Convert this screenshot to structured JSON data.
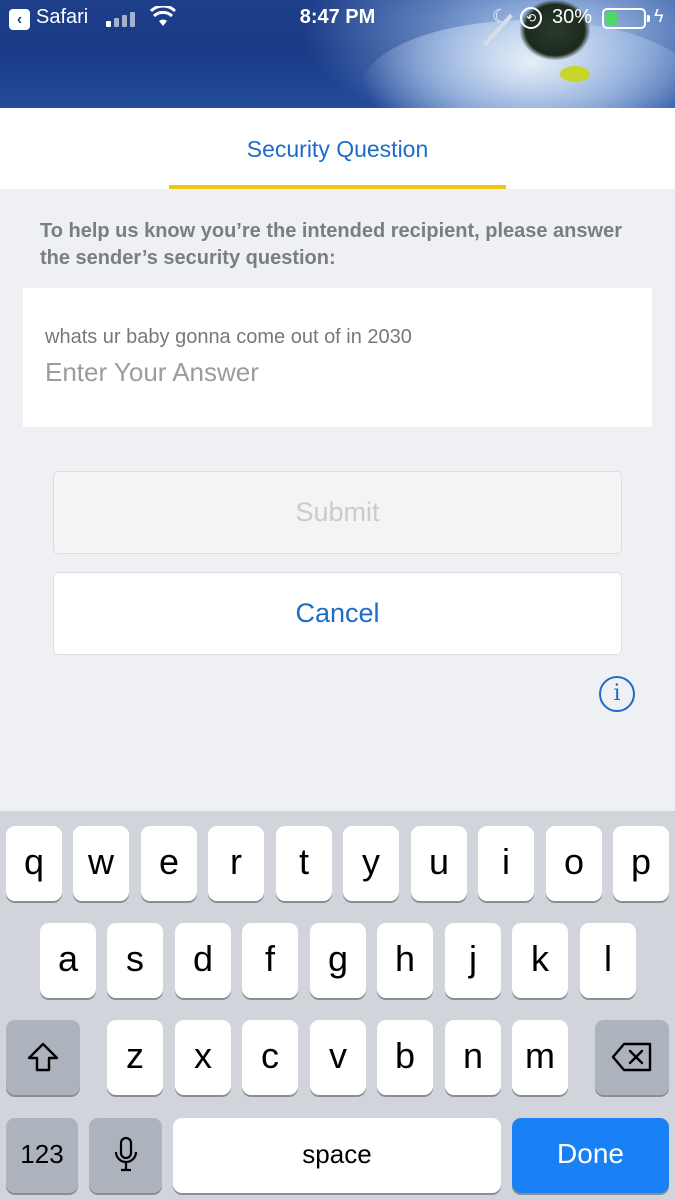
{
  "status_bar": {
    "back_app": "Safari",
    "time": "8:47 PM",
    "battery_percent": "30%",
    "battery_level": 0.3
  },
  "tab": {
    "label": "Security Question",
    "accent_color": "#f2c513"
  },
  "instructions": "To help us know you’re the intended recipient, please answer the sender’s security question:",
  "question": {
    "text": "whats ur baby gonna come out of in 2030",
    "answer_value": "",
    "answer_placeholder": "Enter Your Answer"
  },
  "buttons": {
    "submit": "Submit",
    "cancel": "Cancel"
  },
  "colors": {
    "link_blue": "#1f6cc6",
    "done_blue": "#1a80f5"
  },
  "keyboard": {
    "row1": [
      "q",
      "w",
      "e",
      "r",
      "t",
      "y",
      "u",
      "i",
      "o",
      "p"
    ],
    "row2": [
      "a",
      "s",
      "d",
      "f",
      "g",
      "h",
      "j",
      "k",
      "l"
    ],
    "row3": [
      "z",
      "x",
      "c",
      "v",
      "b",
      "n",
      "m"
    ],
    "numbers_label": "123",
    "space_label": "space",
    "done_label": "Done",
    "icons": {
      "shift": "shift-icon",
      "delete": "backspace-icon",
      "dictation": "microphone-icon",
      "info": "info-icon"
    }
  }
}
